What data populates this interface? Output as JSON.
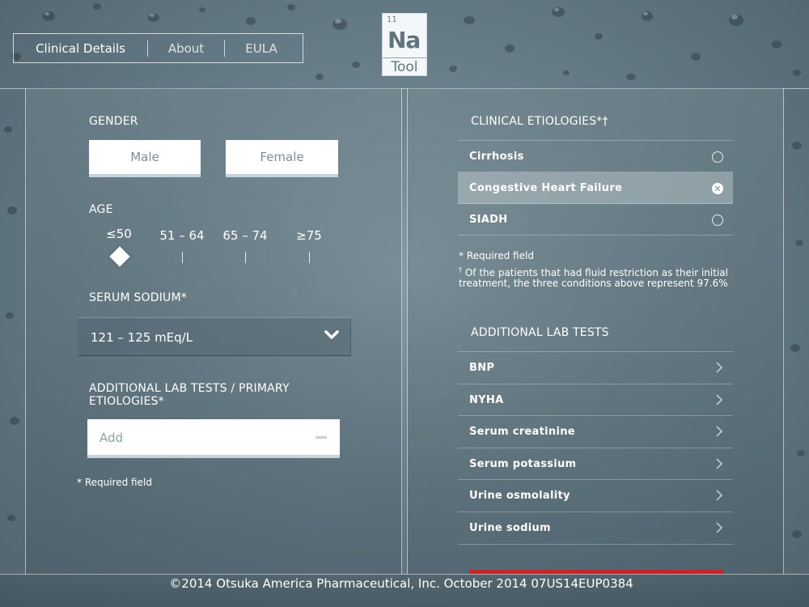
{
  "nav": {
    "tabs": [
      "Clinical Details",
      "About",
      "EULA"
    ],
    "active": "Clinical Details"
  },
  "logo": {
    "number": "11",
    "symbol": "Na",
    "label": "Tool"
  },
  "left": {
    "gender_label": "GENDER",
    "gender_options": [
      "Male",
      "Female"
    ],
    "age_label": "AGE",
    "age_options": [
      "≤50",
      "51 – 64",
      "65 – 74",
      "≥75"
    ],
    "age_selected": "≤50",
    "sodium_label": "SERUM SODIUM*",
    "sodium_value": "121 – 125 mEq/L",
    "additional_label": "ADDITIONAL LAB TESTS / PRIMARY ETIOLOGIES*",
    "add_placeholder": "Add",
    "required_note": "* Required field"
  },
  "right": {
    "etiologies_label": "CLINICAL ETIOLOGIES*†",
    "etiologies": [
      {
        "label": "Cirrhosis",
        "selected": false
      },
      {
        "label": "Congestive Heart Failure",
        "selected": true
      },
      {
        "label": "SIADH",
        "selected": false
      }
    ],
    "required_note": "* Required field",
    "footnote_mark": "†",
    "footnote": "Of the patients that had fluid restriction as their initial treatment, the three conditions above represent 97.6%",
    "lab_label": "ADDITIONAL LAB TESTS",
    "lab_tests": [
      "BNP",
      "NYHA",
      "Serum creatinine",
      "Serum potassium",
      "Urine osmolality",
      "Urine sodium"
    ]
  },
  "footer": {
    "text": "©2014 Otsuka America Pharmaceutical, Inc. October 2014   07US14EUP0384"
  },
  "colors": {
    "background": "#6a7f89",
    "accent_red": "#c0262c",
    "button_shadow": "#c5d4da"
  }
}
